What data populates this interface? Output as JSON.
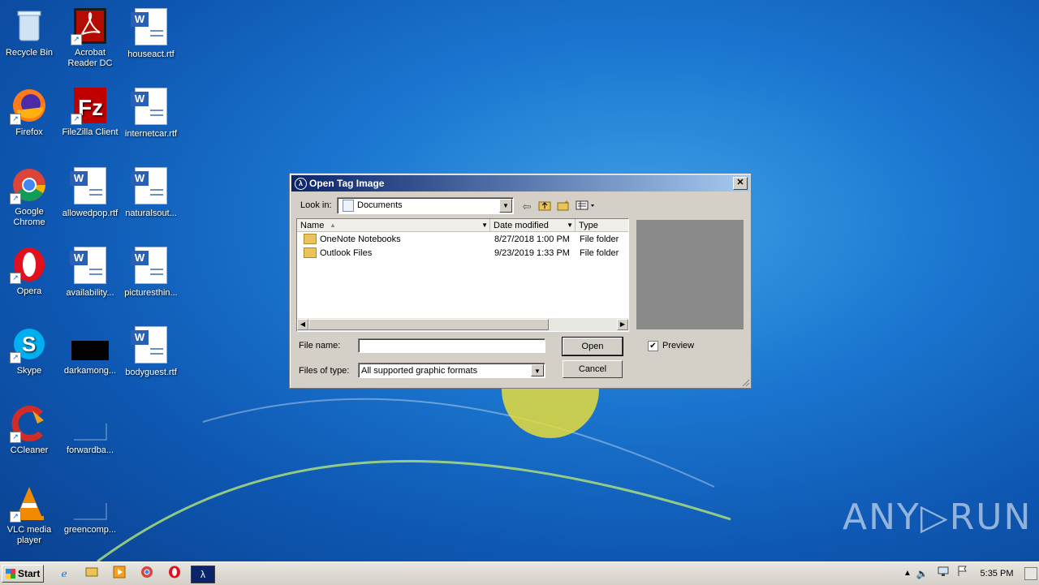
{
  "desktop": {
    "icons": [
      {
        "label": "Recycle Bin"
      },
      {
        "label": "Acrobat Reader DC"
      },
      {
        "label": "houseact.rtf"
      },
      {
        "label": "Firefox"
      },
      {
        "label": "FileZilla Client"
      },
      {
        "label": "internetcar.rtf"
      },
      {
        "label": "Google Chrome"
      },
      {
        "label": "allowedpop.rtf"
      },
      {
        "label": "naturalsout..."
      },
      {
        "label": "Opera"
      },
      {
        "label": "availability..."
      },
      {
        "label": "picturesthin..."
      },
      {
        "label": "Skype"
      },
      {
        "label": "darkamong..."
      },
      {
        "label": "bodyguest.rtf"
      },
      {
        "label": "CCleaner"
      },
      {
        "label": "forwardba..."
      },
      {
        "label": "VLC media player"
      },
      {
        "label": "greencomp..."
      }
    ]
  },
  "dialog": {
    "title": "Open Tag Image",
    "close_glyph": "✕",
    "look_in_label": "Look in:",
    "look_in_value": "Documents",
    "columns": [
      "Name",
      "Date modified",
      "Type"
    ],
    "files": [
      {
        "name": "OneNote Notebooks",
        "date": "8/27/2018 1:00 PM",
        "type": "File folder"
      },
      {
        "name": "Outlook Files",
        "date": "9/23/2019 1:33 PM",
        "type": "File folder"
      }
    ],
    "file_name_label": "File name:",
    "file_name_value": "",
    "files_of_type_label": "Files of type:",
    "files_of_type_value": "All supported graphic formats",
    "open_label": "Open",
    "cancel_label": "Cancel",
    "preview_label": "Preview",
    "preview_checked": true
  },
  "taskbar": {
    "start_label": "Start",
    "clock": "5:35 PM"
  },
  "watermark": "ANY▷RUN"
}
